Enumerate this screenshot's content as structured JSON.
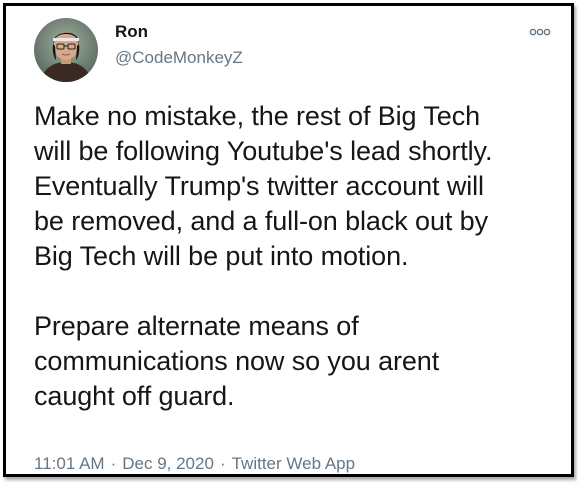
{
  "author": {
    "display_name": "Ron",
    "handle": "@CodeMonkeyZ"
  },
  "tweet": {
    "text": "Make no mistake, the rest of Big Tech\nwill be following Youtube's lead shortly.\nEventually Trump's twitter account will\nbe removed, and a full-on black out by\nBig Tech will be put into motion.\n\nPrepare alternate means of\ncommunications now so you arent\ncaught off guard.",
    "time": "11:01 AM",
    "separator": "·",
    "date": "Dec 9, 2020",
    "source": "Twitter Web App"
  },
  "icons": {
    "avatar": "avatar-photo",
    "more": "more-options-icon"
  },
  "colors": {
    "primary_text": "#14171a",
    "secondary_text": "#657786",
    "border": "#000000"
  }
}
